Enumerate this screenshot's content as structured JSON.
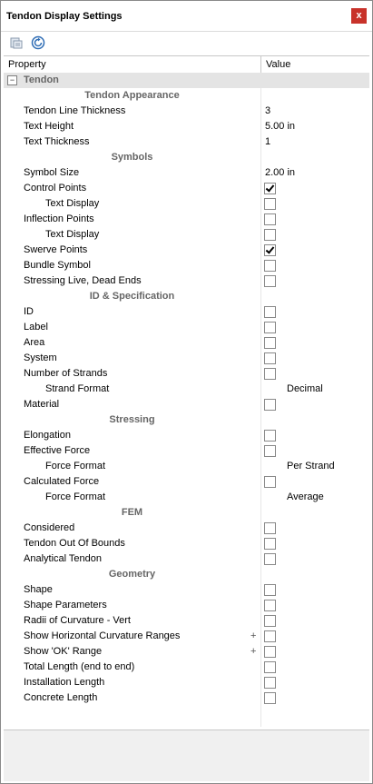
{
  "window": {
    "title": "Tendon Display Settings",
    "close_label": "x"
  },
  "toolbar": {
    "icons": [
      "sort-alphabetical-icon",
      "refresh-icon"
    ]
  },
  "grid": {
    "col_property": "Property",
    "col_value": "Value"
  },
  "category": {
    "label": "Tendon",
    "expander": "−"
  },
  "rows": [
    {
      "kind": "sub",
      "label": "Tendon Appearance"
    },
    {
      "kind": "prop",
      "label": "Tendon Line Thickness",
      "level": 1,
      "value": "3"
    },
    {
      "kind": "prop",
      "label": "Text Height",
      "level": 1,
      "value": "5.00 in"
    },
    {
      "kind": "prop",
      "label": "Text Thickness",
      "level": 1,
      "value": "1"
    },
    {
      "kind": "sub",
      "label": "Symbols"
    },
    {
      "kind": "prop",
      "label": "Symbol Size",
      "level": 1,
      "value": "2.00 in"
    },
    {
      "kind": "prop",
      "label": "Control Points",
      "level": 1,
      "checkbox": true,
      "checked": true
    },
    {
      "kind": "prop",
      "label": "Text Display",
      "level": 2,
      "checkbox": true,
      "checked": false
    },
    {
      "kind": "prop",
      "label": "Inflection Points",
      "level": 1,
      "checkbox": true,
      "checked": false
    },
    {
      "kind": "prop",
      "label": "Text Display",
      "level": 2,
      "checkbox": true,
      "checked": false
    },
    {
      "kind": "prop",
      "label": "Swerve Points",
      "level": 1,
      "checkbox": true,
      "checked": true
    },
    {
      "kind": "prop",
      "label": "Bundle Symbol",
      "level": 1,
      "checkbox": true,
      "checked": false
    },
    {
      "kind": "prop",
      "label": "Stressing Live, Dead Ends",
      "level": 1,
      "checkbox": true,
      "checked": false
    },
    {
      "kind": "sub",
      "label": "ID & Specification"
    },
    {
      "kind": "prop",
      "label": "ID",
      "level": 1,
      "checkbox": true,
      "checked": false
    },
    {
      "kind": "prop",
      "label": "Label",
      "level": 1,
      "checkbox": true,
      "checked": false
    },
    {
      "kind": "prop",
      "label": "Area",
      "level": 1,
      "checkbox": true,
      "checked": false
    },
    {
      "kind": "prop",
      "label": "System",
      "level": 1,
      "checkbox": true,
      "checked": false
    },
    {
      "kind": "prop",
      "label": "Number of Strands",
      "level": 1,
      "checkbox": true,
      "checked": false
    },
    {
      "kind": "prop",
      "label": "Strand Format",
      "level": 2,
      "value": "Decimal",
      "value_indent": true
    },
    {
      "kind": "prop",
      "label": "Material",
      "level": 1,
      "checkbox": true,
      "checked": false
    },
    {
      "kind": "sub",
      "label": "Stressing"
    },
    {
      "kind": "prop",
      "label": "Elongation",
      "level": 1,
      "checkbox": true,
      "checked": false
    },
    {
      "kind": "prop",
      "label": "Effective Force",
      "level": 1,
      "checkbox": true,
      "checked": false
    },
    {
      "kind": "prop",
      "label": "Force Format",
      "level": 2,
      "value": "Per Strand",
      "value_indent": true
    },
    {
      "kind": "prop",
      "label": "Calculated Force",
      "level": 1,
      "checkbox": true,
      "checked": false
    },
    {
      "kind": "prop",
      "label": "Force Format",
      "level": 2,
      "value": "Average",
      "value_indent": true
    },
    {
      "kind": "sub",
      "label": "FEM"
    },
    {
      "kind": "prop",
      "label": "Considered",
      "level": 1,
      "checkbox": true,
      "checked": false
    },
    {
      "kind": "prop",
      "label": "Tendon Out Of Bounds",
      "level": 1,
      "checkbox": true,
      "checked": false
    },
    {
      "kind": "prop",
      "label": "Analytical Tendon",
      "level": 1,
      "checkbox": true,
      "checked": false
    },
    {
      "kind": "sub",
      "label": "Geometry"
    },
    {
      "kind": "prop",
      "label": "Shape",
      "level": 1,
      "checkbox": true,
      "checked": false
    },
    {
      "kind": "prop",
      "label": "Shape Parameters",
      "level": 1,
      "checkbox": true,
      "checked": false
    },
    {
      "kind": "prop",
      "label": "Radii of Curvature - Vert",
      "level": 1,
      "checkbox": true,
      "checked": false
    },
    {
      "kind": "prop",
      "label": "Show Horizontal Curvature Ranges",
      "level": 1,
      "checkbox": true,
      "checked": false,
      "expand": "+"
    },
    {
      "kind": "prop",
      "label": "Show 'OK' Range",
      "level": 1,
      "checkbox": true,
      "checked": false,
      "expand": "+"
    },
    {
      "kind": "prop",
      "label": "Total Length (end to end)",
      "level": 1,
      "checkbox": true,
      "checked": false
    },
    {
      "kind": "prop",
      "label": "Installation Length",
      "level": 1,
      "checkbox": true,
      "checked": false
    },
    {
      "kind": "prop",
      "label": "Concrete Length",
      "level": 1,
      "checkbox": true,
      "checked": false
    }
  ]
}
